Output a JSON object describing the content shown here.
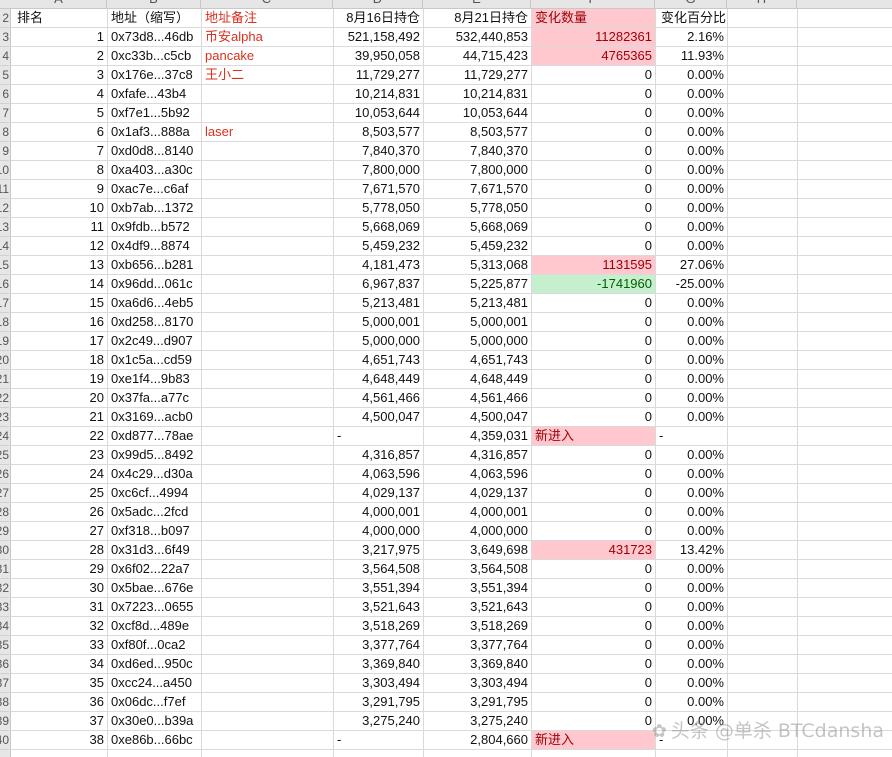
{
  "columns": [
    "A",
    "B",
    "C",
    "D",
    "E",
    "F",
    "G",
    "H"
  ],
  "header": {
    "rank": "排名",
    "address": "地址（缩写）",
    "note": "地址备注",
    "aug16": "8月16日持仓",
    "aug21": "8月21日持仓",
    "change": "变化数量",
    "pct": "变化百分比"
  },
  "row_numbers": [
    "2",
    "3",
    "4",
    "5",
    "6",
    "7",
    "8",
    "9",
    "10",
    "11",
    "12",
    "13",
    "14",
    "15",
    "16",
    "17",
    "18",
    "19",
    "20",
    "21",
    "22",
    "23",
    "24",
    "25",
    "26",
    "27",
    "28",
    "29",
    "30",
    "31",
    "32",
    "33",
    "34",
    "35",
    "36",
    "37",
    "38",
    "39",
    "40"
  ],
  "rows": [
    {
      "rank": "1",
      "address": "0x73d8...46db",
      "note": "币安alpha",
      "aug16": "521,158,492",
      "aug21": "532,440,853",
      "change": "11282361",
      "pct": "2.16%",
      "kind": "pos"
    },
    {
      "rank": "2",
      "address": "0xc33b...c5cb",
      "note": "pancake",
      "aug16": "39,950,058",
      "aug21": "44,715,423",
      "change": "4765365",
      "pct": "11.93%",
      "kind": "pos"
    },
    {
      "rank": "3",
      "address": "0x176e...37c8",
      "note": "王小二",
      "aug16": "11,729,277",
      "aug21": "11,729,277",
      "change": "0",
      "pct": "0.00%",
      "kind": "zero"
    },
    {
      "rank": "4",
      "address": "0xfafe...43b4",
      "note": "",
      "aug16": "10,214,831",
      "aug21": "10,214,831",
      "change": "0",
      "pct": "0.00%",
      "kind": "zero"
    },
    {
      "rank": "5",
      "address": "0xf7e1...5b92",
      "note": "",
      "aug16": "10,053,644",
      "aug21": "10,053,644",
      "change": "0",
      "pct": "0.00%",
      "kind": "zero"
    },
    {
      "rank": "6",
      "address": "0x1af3...888a",
      "note": "laser",
      "aug16": "8,503,577",
      "aug21": "8,503,577",
      "change": "0",
      "pct": "0.00%",
      "kind": "zero"
    },
    {
      "rank": "7",
      "address": "0xd0d8...8140",
      "note": "",
      "aug16": "7,840,370",
      "aug21": "7,840,370",
      "change": "0",
      "pct": "0.00%",
      "kind": "zero"
    },
    {
      "rank": "8",
      "address": "0xa403...a30c",
      "note": "",
      "aug16": "7,800,000",
      "aug21": "7,800,000",
      "change": "0",
      "pct": "0.00%",
      "kind": "zero"
    },
    {
      "rank": "9",
      "address": "0xac7e...c6af",
      "note": "",
      "aug16": "7,671,570",
      "aug21": "7,671,570",
      "change": "0",
      "pct": "0.00%",
      "kind": "zero"
    },
    {
      "rank": "10",
      "address": "0xb7ab...1372",
      "note": "",
      "aug16": "5,778,050",
      "aug21": "5,778,050",
      "change": "0",
      "pct": "0.00%",
      "kind": "zero"
    },
    {
      "rank": "11",
      "address": "0x9fdb...b572",
      "note": "",
      "aug16": "5,668,069",
      "aug21": "5,668,069",
      "change": "0",
      "pct": "0.00%",
      "kind": "zero"
    },
    {
      "rank": "12",
      "address": "0x4df9...8874",
      "note": "",
      "aug16": "5,459,232",
      "aug21": "5,459,232",
      "change": "0",
      "pct": "0.00%",
      "kind": "zero"
    },
    {
      "rank": "13",
      "address": "0xb656...b281",
      "note": "",
      "aug16": "4,181,473",
      "aug21": "5,313,068",
      "change": "1131595",
      "pct": "27.06%",
      "kind": "pos"
    },
    {
      "rank": "14",
      "address": "0x96dd...061c",
      "note": "",
      "aug16": "6,967,837",
      "aug21": "5,225,877",
      "change": "-1741960",
      "pct": "-25.00%",
      "kind": "neg"
    },
    {
      "rank": "15",
      "address": "0xa6d6...4eb5",
      "note": "",
      "aug16": "5,213,481",
      "aug21": "5,213,481",
      "change": "0",
      "pct": "0.00%",
      "kind": "zero"
    },
    {
      "rank": "16",
      "address": "0xd258...8170",
      "note": "",
      "aug16": "5,000,001",
      "aug21": "5,000,001",
      "change": "0",
      "pct": "0.00%",
      "kind": "zero"
    },
    {
      "rank": "17",
      "address": "0x2c49...d907",
      "note": "",
      "aug16": "5,000,000",
      "aug21": "5,000,000",
      "change": "0",
      "pct": "0.00%",
      "kind": "zero"
    },
    {
      "rank": "18",
      "address": "0x1c5a...cd59",
      "note": "",
      "aug16": "4,651,743",
      "aug21": "4,651,743",
      "change": "0",
      "pct": "0.00%",
      "kind": "zero"
    },
    {
      "rank": "19",
      "address": "0xe1f4...9b83",
      "note": "",
      "aug16": "4,648,449",
      "aug21": "4,648,449",
      "change": "0",
      "pct": "0.00%",
      "kind": "zero"
    },
    {
      "rank": "20",
      "address": "0x37fa...a77c",
      "note": "",
      "aug16": "4,561,466",
      "aug21": "4,561,466",
      "change": "0",
      "pct": "0.00%",
      "kind": "zero"
    },
    {
      "rank": "21",
      "address": "0x3169...acb0",
      "note": "",
      "aug16": "4,500,047",
      "aug21": "4,500,047",
      "change": "0",
      "pct": "0.00%",
      "kind": "zero"
    },
    {
      "rank": "22",
      "address": "0xd877...78ae",
      "note": "",
      "aug16": "-",
      "aug21": "4,359,031",
      "change": "新进入",
      "pct": "-",
      "kind": "new"
    },
    {
      "rank": "23",
      "address": "0x99d5...8492",
      "note": "",
      "aug16": "4,316,857",
      "aug21": "4,316,857",
      "change": "0",
      "pct": "0.00%",
      "kind": "zero"
    },
    {
      "rank": "24",
      "address": "0x4c29...d30a",
      "note": "",
      "aug16": "4,063,596",
      "aug21": "4,063,596",
      "change": "0",
      "pct": "0.00%",
      "kind": "zero"
    },
    {
      "rank": "25",
      "address": "0xc6cf...4994",
      "note": "",
      "aug16": "4,029,137",
      "aug21": "4,029,137",
      "change": "0",
      "pct": "0.00%",
      "kind": "zero"
    },
    {
      "rank": "26",
      "address": "0x5adc...2fcd",
      "note": "",
      "aug16": "4,000,001",
      "aug21": "4,000,001",
      "change": "0",
      "pct": "0.00%",
      "kind": "zero"
    },
    {
      "rank": "27",
      "address": "0xf318...b097",
      "note": "",
      "aug16": "4,000,000",
      "aug21": "4,000,000",
      "change": "0",
      "pct": "0.00%",
      "kind": "zero"
    },
    {
      "rank": "28",
      "address": "0x31d3...6f49",
      "note": "",
      "aug16": "3,217,975",
      "aug21": "3,649,698",
      "change": "431723",
      "pct": "13.42%",
      "kind": "pos"
    },
    {
      "rank": "29",
      "address": "0x6f02...22a7",
      "note": "",
      "aug16": "3,564,508",
      "aug21": "3,564,508",
      "change": "0",
      "pct": "0.00%",
      "kind": "zero"
    },
    {
      "rank": "30",
      "address": "0x5bae...676e",
      "note": "",
      "aug16": "3,551,394",
      "aug21": "3,551,394",
      "change": "0",
      "pct": "0.00%",
      "kind": "zero"
    },
    {
      "rank": "31",
      "address": "0x7223...0655",
      "note": "",
      "aug16": "3,521,643",
      "aug21": "3,521,643",
      "change": "0",
      "pct": "0.00%",
      "kind": "zero"
    },
    {
      "rank": "32",
      "address": "0xcf8d...489e",
      "note": "",
      "aug16": "3,518,269",
      "aug21": "3,518,269",
      "change": "0",
      "pct": "0.00%",
      "kind": "zero"
    },
    {
      "rank": "33",
      "address": "0xf80f...0ca2",
      "note": "",
      "aug16": "3,377,764",
      "aug21": "3,377,764",
      "change": "0",
      "pct": "0.00%",
      "kind": "zero"
    },
    {
      "rank": "34",
      "address": "0xd6ed...950c",
      "note": "",
      "aug16": "3,369,840",
      "aug21": "3,369,840",
      "change": "0",
      "pct": "0.00%",
      "kind": "zero"
    },
    {
      "rank": "35",
      "address": "0xcc24...a450",
      "note": "",
      "aug16": "3,303,494",
      "aug21": "3,303,494",
      "change": "0",
      "pct": "0.00%",
      "kind": "zero"
    },
    {
      "rank": "36",
      "address": "0x06dc...f7ef",
      "note": "",
      "aug16": "3,291,795",
      "aug21": "3,291,795",
      "change": "0",
      "pct": "0.00%",
      "kind": "zero"
    },
    {
      "rank": "37",
      "address": "0x30e0...b39a",
      "note": "",
      "aug16": "3,275,240",
      "aug21": "3,275,240",
      "change": "0",
      "pct": "0.00%",
      "kind": "zero"
    },
    {
      "rank": "38",
      "address": "0xe86b...66bc",
      "note": "",
      "aug16": "-",
      "aug21": "2,804,660",
      "change": "新进入",
      "pct": "-",
      "kind": "new"
    }
  ],
  "watermark": "头条 @单杀 BTCdansha",
  "colors": {
    "increase_fill": "#ffc7ce",
    "increase_text": "#9c0006",
    "decrease_fill": "#c6efce",
    "decrease_text": "#006100",
    "note_text": "#d9301f"
  }
}
